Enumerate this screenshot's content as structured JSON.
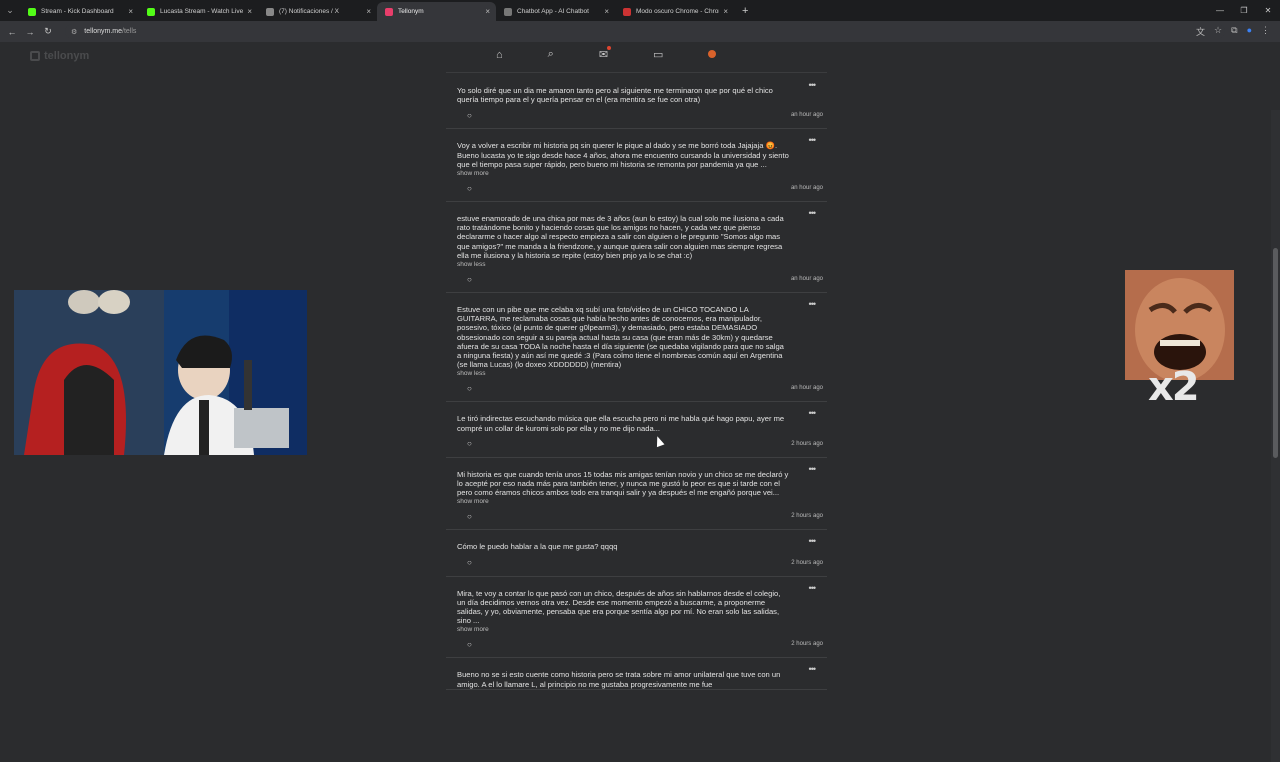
{
  "tabs": [
    {
      "title": "Stream - Kick Dashboard",
      "color": "#53fc18",
      "close": "×"
    },
    {
      "title": "Lucasta Stream - Watch Live on",
      "color": "#53fc18",
      "close": "×"
    },
    {
      "title": "(7) Notificaciones / X",
      "color": "#888888",
      "close": "×"
    },
    {
      "title": "Tellonym",
      "color": "#e83e6b",
      "close": "×"
    },
    {
      "title": "Chatbot App - AI Chatbot",
      "color": "#777777",
      "close": "×"
    },
    {
      "title": "Modo oscuro Chrome - Chrom",
      "color": "#cc3333",
      "close": "×"
    }
  ],
  "address": {
    "domain": "tellonym.me",
    "path": "/tells"
  },
  "logo": "tellonym",
  "overlay": {
    "meme_label": "x2"
  },
  "tells": [
    {
      "text": "Yo solo diré que un dia me amaron tanto pero al siguiente me terminaron que por qué el chico quería tiempo para el y quería pensar en el (era mentira se fue con otra)",
      "more": "",
      "time": "an hour ago"
    },
    {
      "text": "Voy a volver a escribir mi historia pq sin querer le pique al dado y se me borró toda Jajajaja 😡. Bueno lucasta yo te sigo desde hace 4 años, ahora me encuentro cursando la universidad y siento que el tiempo pasa super rápido, pero bueno mi historia se remonta por pandemia ya que ...",
      "more": "show more",
      "time": "an hour ago"
    },
    {
      "text": "estuve enamorado de una chica por mas de 3 años (aun lo estoy) la cual solo me ilusiona a cada rato tratándome bonito y haciendo cosas que los amigos no hacen, y cada vez que pienso declararme o hacer algo al respecto empieza a salir con alguien o le pregunto \"Somos algo mas que amigos?\" me manda a la friendzone, y aunque quiera salir con alguien mas siempre regresa ella me ilusiona y la historia se repite (estoy bien pnjo ya lo se chat :c)",
      "more": "show less",
      "time": "an hour ago"
    },
    {
      "text": "Estuve con un pibe que me celaba xq subí una foto/video de un CHICO TOCANDO LA GUITARRA, me reclamaba cosas que había hecho antes de conocernos, era manipulador, posesivo, tóxico (al punto de querer g0lpearm3), y demasiado, pero estaba DEMASIADO obsesionado con seguir a su pareja actual hasta su casa (que eran más de 30km) y quedarse afuera de su casa TODA la noche hasta el día siguiente (se quedaba vigilando para que no salga a ninguna fiesta) y aún así me quedé :3 (Para colmo tiene el nombreas común aquí en Argentina (se llama Lucas) (lo doxeo XDDDDDD) (mentira)",
      "more": "show less",
      "time": "an hour ago"
    },
    {
      "text": "Le tiró indirectas escuchando música que ella escucha pero ni me habla qué hago papu, ayer me compré un collar de kuromi solo por ella y no me dijo nada...",
      "more": "",
      "time": "2 hours ago"
    },
    {
      "text": "Mi historia es que cuando tenía unos 15 todas mis amigas tenían novio y un chico se me declaró y lo acepté por eso nada más para también tener, y nunca me gustó lo peor es que si tarde con el pero como éramos chicos ambos todo era tranqui salir y ya después el me engañó porque vei...",
      "more": "show more",
      "time": "2 hours ago"
    },
    {
      "text": "Cómo le puedo hablar a la que me gusta? qqqq",
      "more": "",
      "time": "2 hours ago"
    },
    {
      "text": "Mira, te voy a contar lo que pasó con un chico, después de años sin hablarnos desde el colegio, un día decidimos vernos otra vez. Desde ese momento empezó a buscarme, a proponerme salidas, y yo, obviamente, pensaba que era porque sentía algo por mí. No eran solo las salidas, sino ...",
      "more": "show more",
      "time": "2 hours ago"
    },
    {
      "text": "Bueno no se si esto cuente como historia pero se trata sobre mi amor unilateral que tuve con un amigo. A el lo llamare L, al principio no me gustaba progresivamente me fue",
      "more": "",
      "time": ""
    }
  ]
}
